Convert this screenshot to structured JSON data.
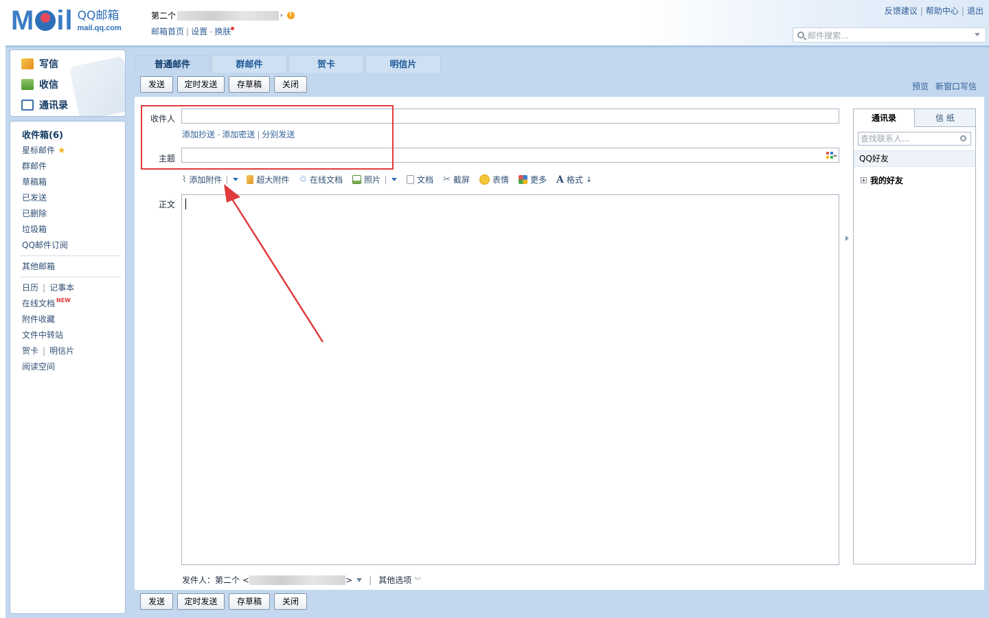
{
  "header": {
    "logo_text": "Mail",
    "logo_cn": "QQ邮箱",
    "logo_domain": "mail.qq.com",
    "account_name": "第二个",
    "links": [
      "邮箱首页",
      "设置",
      "换肤"
    ],
    "top_right": [
      "反馈建议",
      "帮助中心",
      "退出"
    ],
    "search_placeholder": "邮件搜索..."
  },
  "sidebar": {
    "main_actions": [
      "写信",
      "收信",
      "通讯录"
    ],
    "inbox_label": "收件箱(6)",
    "folders": [
      "星标邮件",
      "群邮件",
      "草稿箱",
      "已发送",
      "已删除",
      "垃圾箱",
      "QQ邮件订阅"
    ],
    "other_mailbox": "其他邮箱",
    "tools": {
      "calendar": "日历",
      "notebook": "记事本",
      "online_docs": "在线文档",
      "new_badge": "NEW",
      "attachments": "附件收藏",
      "file_transfer": "文件中转站",
      "card": "贺卡",
      "postcard": "明信片",
      "reading": "阅读空间"
    }
  },
  "compose": {
    "tabs": [
      "普通邮件",
      "群邮件",
      "贺卡",
      "明信片"
    ],
    "buttons": [
      "发送",
      "定时发送",
      "存草稿",
      "关闭"
    ],
    "right_links": [
      "预览",
      "新窗口写信"
    ],
    "to_label": "收件人",
    "to_value": "",
    "cc_links": [
      "添加抄送",
      "添加密送",
      "分别发送"
    ],
    "subject_label": "主题",
    "subject_value": "",
    "editor_tools": [
      "添加附件",
      "超大附件",
      "在线文档",
      "照片",
      "文档",
      "截屏",
      "表情",
      "更多",
      "格式"
    ],
    "body_label": "正文",
    "body_value": "",
    "sender_label": "发件人：",
    "sender_name": "第二个",
    "other_options": "其他选项"
  },
  "contacts_panel": {
    "tabs": [
      "通讯录",
      "信 纸"
    ],
    "search_placeholder": "查找联系人...",
    "group_title": "QQ好友",
    "subgroup": "我的好友"
  },
  "colors": {
    "frame_blue": "#c3d7ee",
    "link_blue": "#2f5f96",
    "annotation_red": "#e03a3a"
  }
}
